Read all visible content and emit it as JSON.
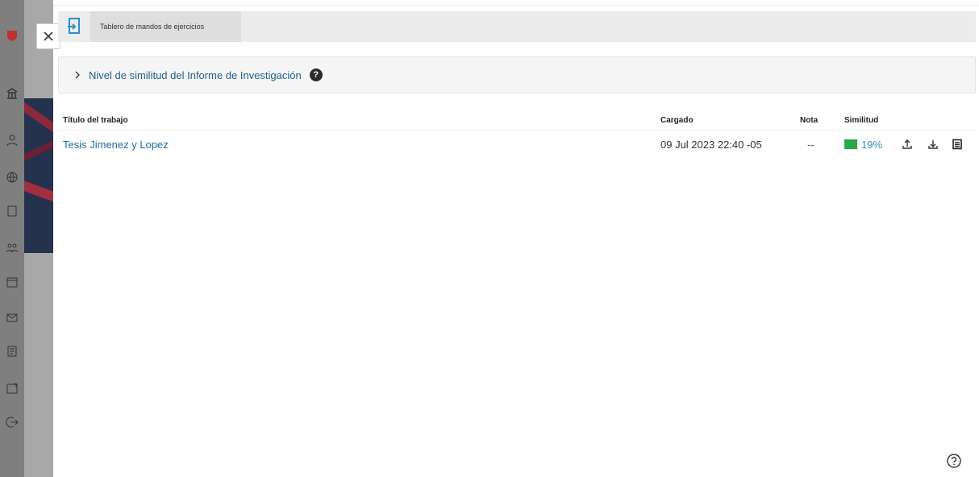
{
  "toolbar": {
    "tab_label": "Tablero de mandos de ejercicios"
  },
  "section": {
    "title": "Nivel de similitud del Informe de Investigación",
    "help_icon": "question-circle-icon"
  },
  "table": {
    "headers": {
      "title": "Título del trabajo",
      "uploaded": "Cargado",
      "grade": "Nota",
      "similarity": "Similitud"
    },
    "rows": [
      {
        "title": "Tesis Jimenez y Lopez",
        "uploaded": "09 Jul 2023 22:40 -05",
        "grade": "--",
        "similarity": "19%",
        "similarity_color": "#28a745"
      }
    ]
  },
  "icons": {
    "close": "close-icon",
    "toolbar": "assignment-inbox-icon",
    "upload": "upload-icon",
    "download": "download-icon",
    "details": "document-list-icon",
    "help": "help-circle-icon"
  },
  "colors": {
    "link": "#1d6aa0",
    "similarity_green": "#28a745"
  }
}
